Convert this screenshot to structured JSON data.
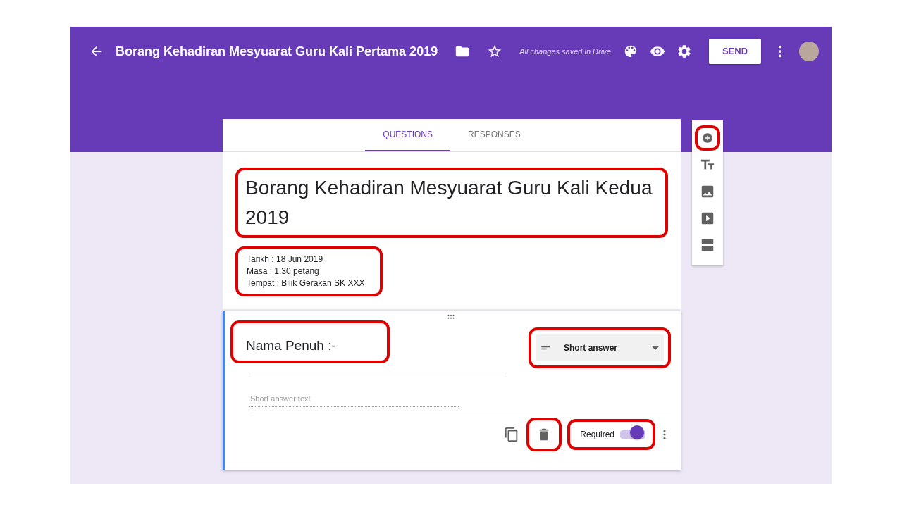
{
  "header": {
    "title": "Borang Kehadiran Mesyuarat Guru Kali Pertama 2019",
    "save_status": "All changes saved in Drive",
    "send_button": "SEND"
  },
  "tabs": [
    {
      "label": "QUESTIONS",
      "selected": true
    },
    {
      "label": "RESPONSES",
      "selected": false
    }
  ],
  "form": {
    "title": "Borang Kehadiran Mesyuarat Guru Kali Kedua 2019",
    "title_highlighted": true,
    "description": [
      "Tarikh : 18 Jun 2019",
      "Masa : 1.30 petang",
      "Tempat : Bilik Gerakan SK XXX"
    ],
    "description_highlighted": true
  },
  "question": {
    "title": "Nama Penuh :-",
    "title_highlighted": true,
    "type": "Short answer",
    "type_highlighted": true,
    "answer_placeholder": "Short answer text",
    "delete_highlighted": true,
    "required_label": "Required",
    "required": true,
    "required_highlighted": true
  },
  "toolbar": [
    {
      "kind": "add",
      "highlighted": true
    },
    {
      "kind": "title",
      "highlighted": false
    },
    {
      "kind": "image",
      "highlighted": false
    },
    {
      "kind": "video",
      "highlighted": false
    },
    {
      "kind": "section",
      "highlighted": false
    }
  ]
}
